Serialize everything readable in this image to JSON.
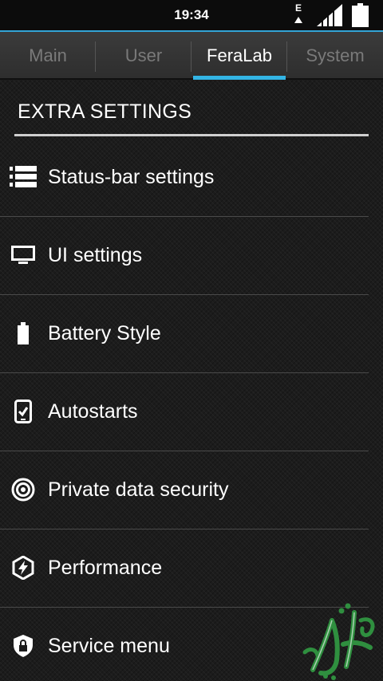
{
  "status_bar": {
    "time": "19:34",
    "network_type": "E",
    "signal_icon": "signal-bars-icon",
    "battery_icon": "battery-icon"
  },
  "tabs": [
    {
      "label": "Main",
      "active": false
    },
    {
      "label": "User",
      "active": false
    },
    {
      "label": "FeraLab",
      "active": true
    },
    {
      "label": "System",
      "active": false
    }
  ],
  "section": {
    "title": "EXTRA SETTINGS"
  },
  "items": [
    {
      "label": "Status-bar settings",
      "icon": "list-icon"
    },
    {
      "label": "UI settings",
      "icon": "monitor-icon"
    },
    {
      "label": "Battery Style",
      "icon": "battery-icon"
    },
    {
      "label": "Autostarts",
      "icon": "phone-check-icon"
    },
    {
      "label": "Private data security",
      "icon": "target-icon"
    },
    {
      "label": "Performance",
      "icon": "lightning-icon"
    },
    {
      "label": "Service menu",
      "icon": "shield-lock-icon"
    }
  ],
  "colors": {
    "accent": "#33b5e5",
    "status_line": "#33a4d6",
    "background": "#1c1c1c",
    "tab_inactive_text": "#7a7a7a",
    "watermark_green": "#2f8f3f"
  }
}
